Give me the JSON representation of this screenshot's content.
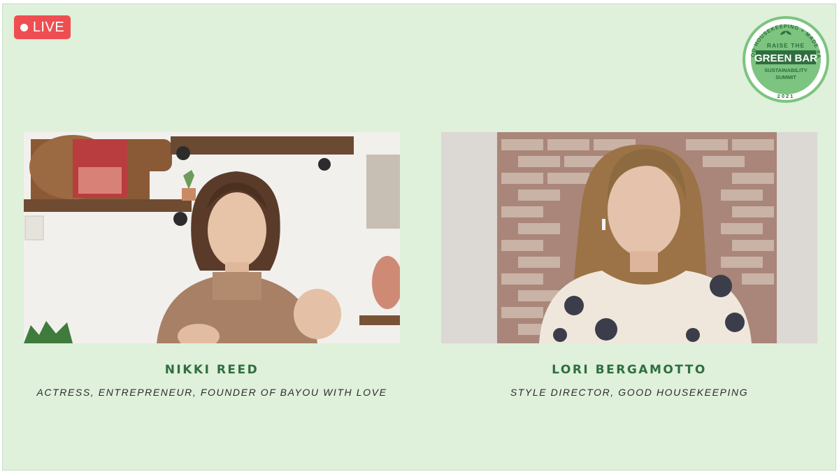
{
  "live_badge": {
    "label": "LIVE",
    "color": "#ee4e52"
  },
  "logo": {
    "top_arc": "GOOD HOUSEKEEPING + MADE SAFE",
    "line1": "RAISE THE",
    "line2": "GREEN BAR",
    "line3": "SUSTAINABILITY",
    "line4": "SUMMIT",
    "year": "2021"
  },
  "speakers": [
    {
      "name": "NIKKI REED",
      "title": "ACTRESS, ENTREPRENEUR, FOUNDER OF BAYOU WITH LOVE"
    },
    {
      "name": "LORI BERGAMOTTO",
      "title": "STYLE DIRECTOR, GOOD HOUSEKEEPING"
    }
  ],
  "colors": {
    "background": "#dff0db",
    "accent_green": "#2f6e3e",
    "logo_green": "#7cc47f"
  }
}
